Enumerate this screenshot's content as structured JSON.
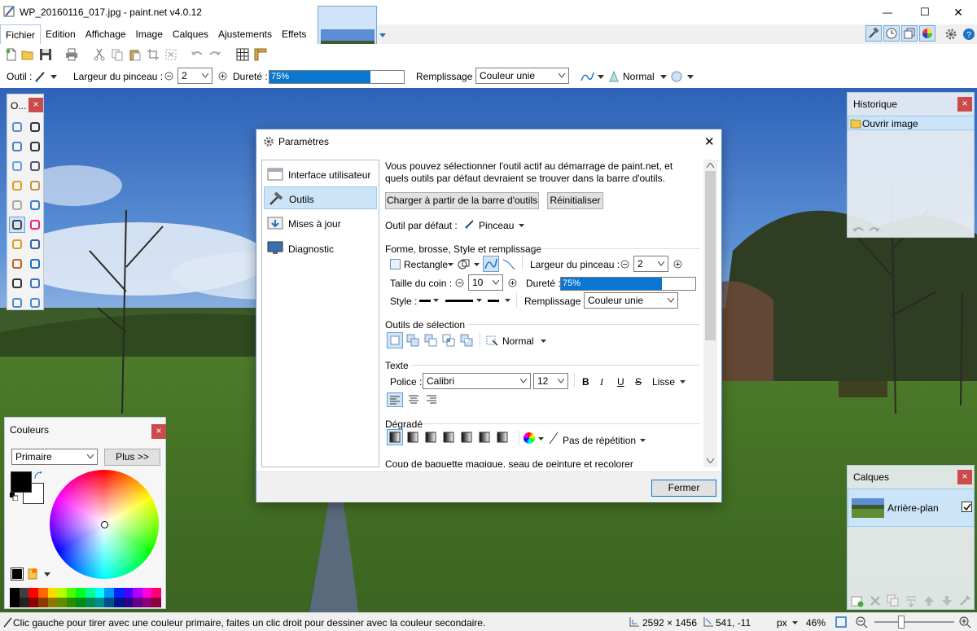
{
  "window": {
    "title": "WP_20160116_017.jpg - paint.net v4.0.12",
    "minimize_label": "—",
    "maximize_label": "☐",
    "close_label": "✕"
  },
  "menu": [
    "Fichier",
    "Edition",
    "Affichage",
    "Image",
    "Calques",
    "Ajustements",
    "Effets"
  ],
  "toolbar": {
    "tool_label": "Outil :",
    "brush_width_label": "Largeur du pinceau :",
    "brush_width_value": "2",
    "hardness_label": "Dureté :",
    "hardness_value": "75%",
    "hardness_fraction": 0.75,
    "fill_label": "Remplissage :",
    "fill_value": "Couleur unie",
    "blend_value": "Normal"
  },
  "tools_panel": {
    "title": "O..."
  },
  "colors_panel": {
    "title": "Couleurs",
    "mode": "Primaire",
    "more_button": "Plus >>",
    "primary_color": "#000000",
    "secondary_color": "#ffffff",
    "palette": [
      "#000000",
      "#404040",
      "#ff0000",
      "#ff6a00",
      "#ffd800",
      "#b6ff00",
      "#4cff00",
      "#00ff21",
      "#00ff90",
      "#00ffff",
      "#0094ff",
      "#0026ff",
      "#4800ff",
      "#b200ff",
      "#ff00dc",
      "#ff006e"
    ]
  },
  "history_panel": {
    "title": "Historique",
    "items": [
      "Ouvrir image"
    ]
  },
  "layers_panel": {
    "title": "Calques",
    "layers": [
      {
        "name": "Arrière-plan",
        "visible": true
      }
    ]
  },
  "dialog": {
    "title": "Paramètres",
    "nav": [
      "Interface utilisateur",
      "Outils",
      "Mises à jour",
      "Diagnostic"
    ],
    "selected_nav": 1,
    "intro": "Vous pouvez sélectionner l'outil actif au démarrage de paint.net, et quels outils par défaut devraient se trouver dans la barre d'outils.",
    "load_button": "Charger à partir de la barre d'outils",
    "reset_button": "Réinitialiser",
    "default_tool_label": "Outil par défaut :",
    "default_tool_value": "Pinceau",
    "sec_shape": "Forme, brosse, Style et remplissage",
    "shape_value": "Rectangle",
    "brush_width_label": "Largeur du pinceau :",
    "brush_width_value": "2",
    "corner_label": "Taille du coin :",
    "corner_value": "10",
    "hardness_label": "Dureté :",
    "hardness_value": "75%",
    "hardness_fraction": 0.75,
    "style_label": "Style :",
    "fill_label": "Remplissage :",
    "fill_value": "Couleur unie",
    "sec_selection": "Outils de sélection",
    "selection_mode": "Normal",
    "sec_text": "Texte",
    "font_label": "Police :",
    "font_value": "Calibri",
    "font_size": "12",
    "bold": "B",
    "italic": "I",
    "underline": "U",
    "strike": "S",
    "antialias": "Lisse",
    "sec_gradient": "Dégradé",
    "gradient_repeat": "Pas de répétition",
    "sec_magic": "Coup de baguette magique, seau de peinture et recolorer",
    "close_button": "Fermer"
  },
  "status": {
    "hint": "Clic gauche pour tirer avec une couleur primaire, faites un clic droit pour dessiner avec la couleur secondaire.",
    "image_size": "2592 × 1456",
    "cursor_pos": "541, -11",
    "units": "px",
    "zoom": "46%"
  }
}
